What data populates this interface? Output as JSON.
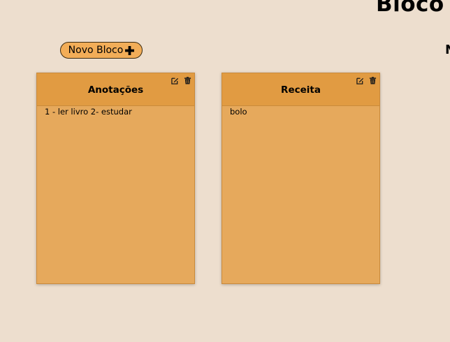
{
  "header": {
    "title": "Bloco",
    "side_letter": "N"
  },
  "toolbar": {
    "new_button_label": "Novo Bloco",
    "new_button_icon": "plus-icon"
  },
  "notes": [
    {
      "title": "Anotações",
      "content": "1 - ler livro 2- estudar",
      "edit_icon": "edit-icon",
      "delete_icon": "trash-icon"
    },
    {
      "title": "Receita",
      "content": "bolo",
      "edit_icon": "edit-icon",
      "delete_icon": "trash-icon"
    }
  ],
  "colors": {
    "background": "#eddece",
    "card_body": "#e6a95c",
    "card_header": "#e19b42",
    "button": "#f2ad58"
  }
}
